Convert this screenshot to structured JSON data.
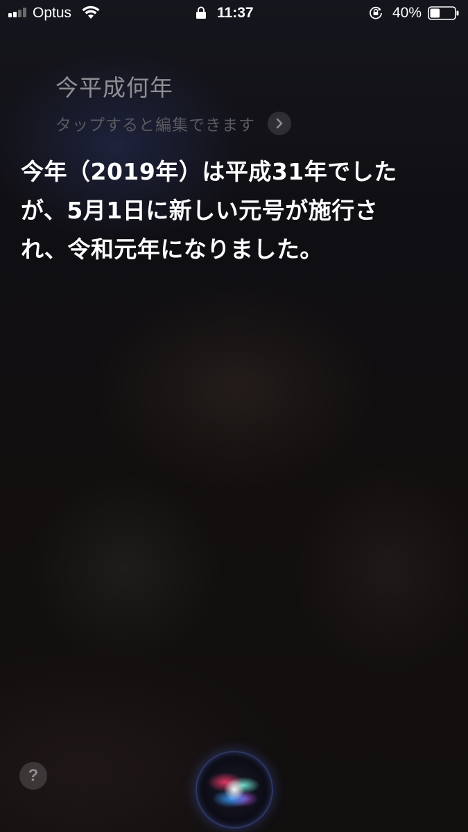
{
  "status_bar": {
    "carrier": "Optus",
    "time": "11:37",
    "battery_percent": "40%",
    "battery_level": 0.4,
    "signal_bars_filled": 2,
    "signal_bars_total": 4,
    "icons": [
      "signal-icon",
      "wifi-icon",
      "lock-icon",
      "rotation-lock-icon",
      "battery-icon"
    ]
  },
  "siri": {
    "query": "今平成何年",
    "edit_hint": "タップすると編集できます",
    "answer_lines": [
      "今年（2019年）は平成31年でした",
      "が、5月1日に新しい元号が施行さ",
      "れ、令和元年になりました。"
    ]
  },
  "bottom": {
    "help_label": "?",
    "orb_icon": "siri-orb-icon"
  }
}
